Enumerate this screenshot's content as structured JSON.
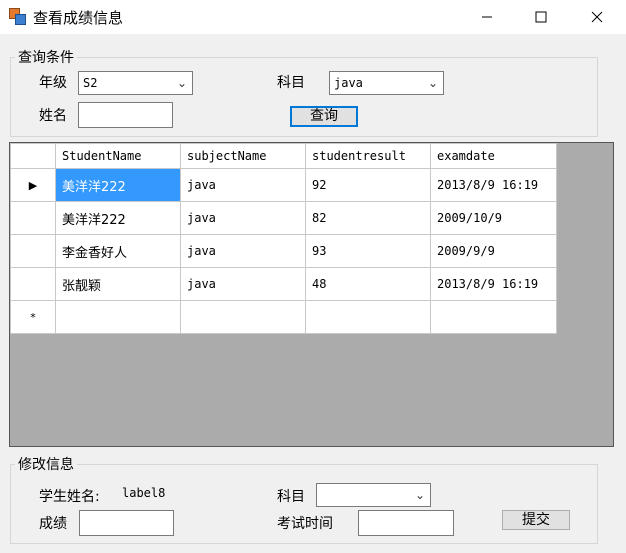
{
  "window": {
    "title": "查看成绩信息"
  },
  "query": {
    "group_label": "查询条件",
    "grade_label": "年级",
    "grade_value": "S2",
    "subject_label": "科目",
    "subject_value": "java",
    "name_label": "姓名",
    "name_value": "",
    "search_button": "查询"
  },
  "grid": {
    "columns": [
      "StudentName",
      "subjectName",
      "studentresult",
      "examdate"
    ],
    "rows": [
      {
        "indicator": "▶",
        "cells": [
          "美洋洋222",
          "java",
          "92",
          "2013/8/9 16:19"
        ]
      },
      {
        "indicator": "",
        "cells": [
          "美洋洋222",
          "java",
          "82",
          "2009/10/9"
        ]
      },
      {
        "indicator": "",
        "cells": [
          "李金香好人",
          "java",
          "93",
          "2009/9/9"
        ]
      },
      {
        "indicator": "",
        "cells": [
          "张靓颖",
          "java",
          "48",
          "2013/8/9 16:19"
        ]
      }
    ],
    "new_row_indicator": "*"
  },
  "edit": {
    "group_label": "修改信息",
    "student_name_label": "学生姓名:",
    "student_name_value": "label8",
    "subject_label": "科目",
    "subject_value": "",
    "score_label": "成绩",
    "score_value": "",
    "exam_time_label": "考试时间",
    "exam_time_value": "",
    "submit_button": "提交"
  }
}
